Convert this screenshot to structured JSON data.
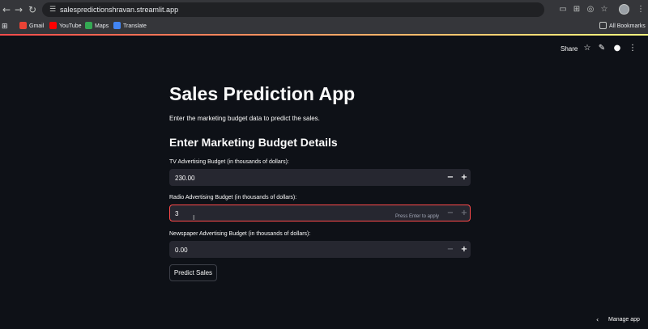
{
  "browser": {
    "url": "salespredictionshravan.streamlit.app",
    "bookmarks": [
      {
        "label": "Gmail",
        "color": "#ea4335"
      },
      {
        "label": "YouTube",
        "color": "#ff0000"
      },
      {
        "label": "Maps",
        "color": "#34a853"
      },
      {
        "label": "Translate",
        "color": "#4285f4"
      }
    ],
    "all_bookmarks": "All Bookmarks"
  },
  "header": {
    "share_label": "Share"
  },
  "page": {
    "title": "Sales Prediction App",
    "subtitle": "Enter the marketing budget data to predict the sales.",
    "section_title": "Enter Marketing Budget Details"
  },
  "fields": [
    {
      "label": "TV Advertising Budget (in thousands of dollars):",
      "value": "230.00"
    },
    {
      "label": "Radio Advertising Budget (in thousands of dollars):",
      "value": "3",
      "hint": "Press Enter to apply"
    },
    {
      "label": "Newspaper Advertising Budget (in thousands of dollars):",
      "value": "0.00"
    }
  ],
  "button": {
    "predict_label": "Predict Sales"
  },
  "footer": {
    "manage_label": "Manage app"
  },
  "colors": {
    "background": "#0e1117",
    "input_bg": "#262730",
    "focus": "#ff4b4b"
  }
}
